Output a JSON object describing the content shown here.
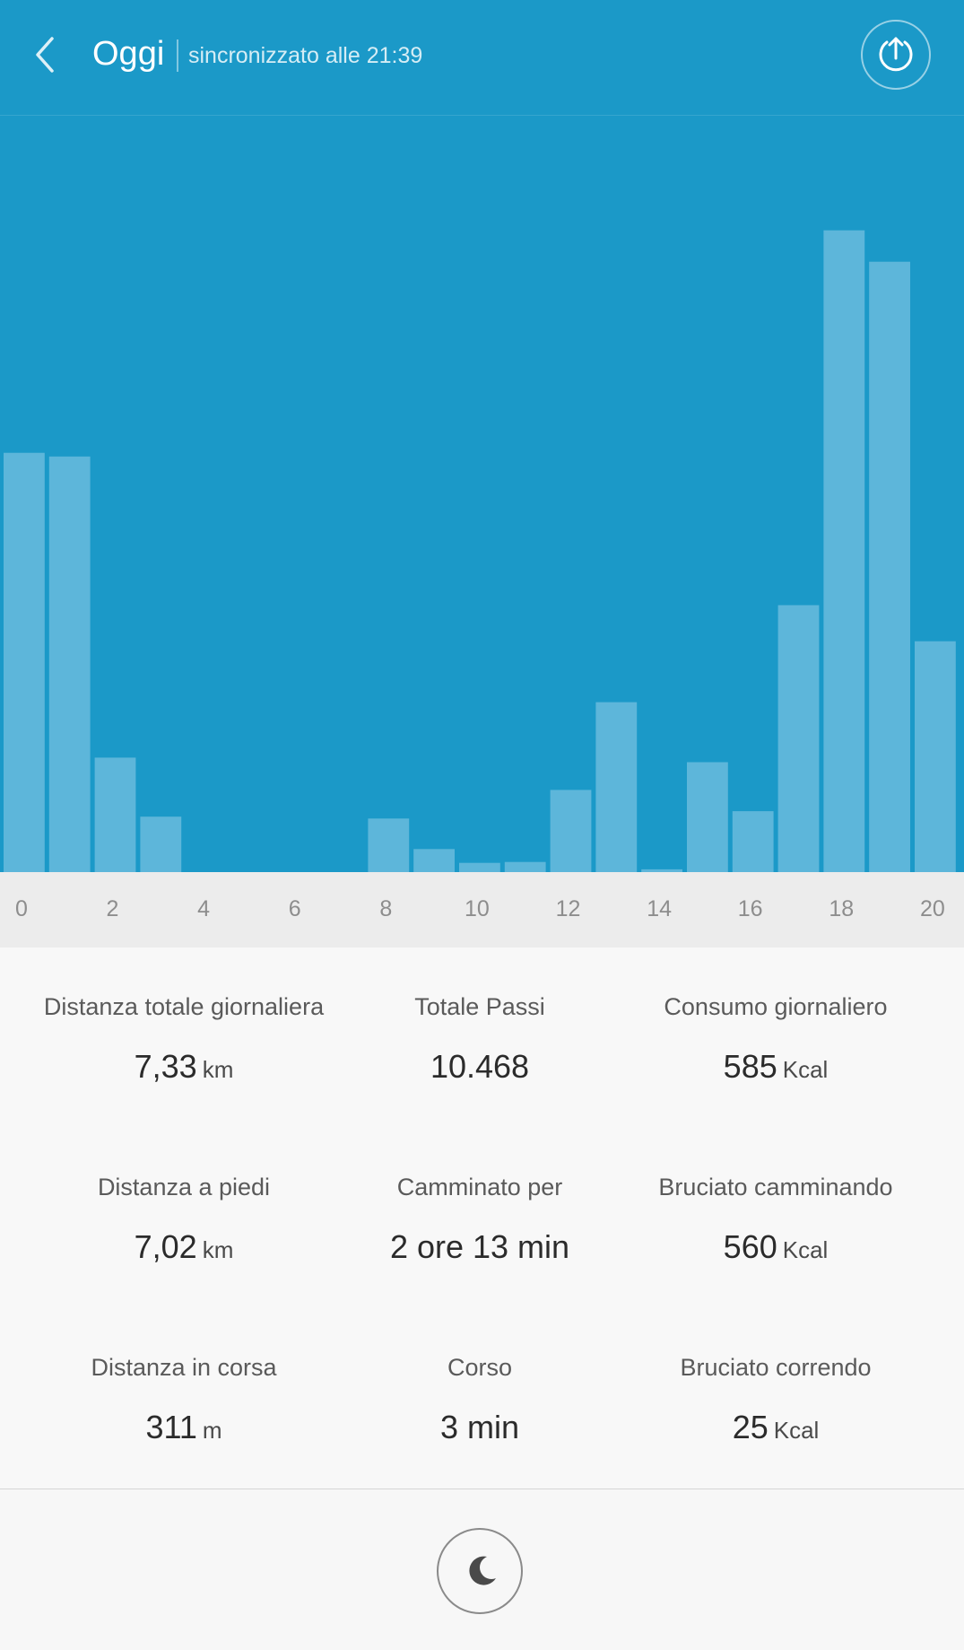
{
  "colors": {
    "header_bg": "#1b99c8",
    "bar": "#5db6da",
    "axis_band": "#ececec",
    "stats_bg": "#f8f8f8"
  },
  "header": {
    "back_icon": "chevron-left-icon",
    "title": "Oggi",
    "subtitle": "sincronizzato alle 21:39",
    "share_icon": "upload-icon"
  },
  "chart_data": {
    "type": "bar",
    "x": [
      0,
      1,
      2,
      3,
      4,
      5,
      6,
      7,
      8,
      9,
      10,
      11,
      12,
      13,
      14,
      15,
      16,
      17,
      18,
      19,
      20
    ],
    "values": [
      454,
      450,
      124,
      60,
      0,
      0,
      0,
      0,
      58,
      25,
      10,
      11,
      89,
      184,
      3,
      119,
      66,
      289,
      695,
      661,
      250
    ],
    "xticks": [
      "0",
      "2",
      "4",
      "6",
      "8",
      "10",
      "12",
      "14",
      "16",
      "18",
      "20"
    ],
    "xtick_values": [
      0,
      2,
      4,
      6,
      8,
      10,
      12,
      14,
      16,
      18,
      20
    ],
    "ylim": [
      0,
      820
    ],
    "grid": false,
    "bar_color": "#5db6da"
  },
  "stats": [
    {
      "label": "Distanza totale giornaliera",
      "value": "7,33",
      "unit": "km"
    },
    {
      "label": "Totale Passi",
      "value": "10.468",
      "unit": ""
    },
    {
      "label": "Consumo giornaliero",
      "value": "585",
      "unit": "Kcal"
    },
    {
      "label": "Distanza a piedi",
      "value": "7,02",
      "unit": "km"
    },
    {
      "label": "Camminato per",
      "value": "2 ore 13 min",
      "unit": ""
    },
    {
      "label": "Bruciato camminando",
      "value": "560",
      "unit": "Kcal"
    },
    {
      "label": "Distanza in corsa",
      "value": "311",
      "unit": "m"
    },
    {
      "label": "Corso",
      "value": "3 min",
      "unit": ""
    },
    {
      "label": "Bruciato correndo",
      "value": "25",
      "unit": "Kcal"
    }
  ],
  "bottom": {
    "sleep_icon": "moon-icon"
  }
}
